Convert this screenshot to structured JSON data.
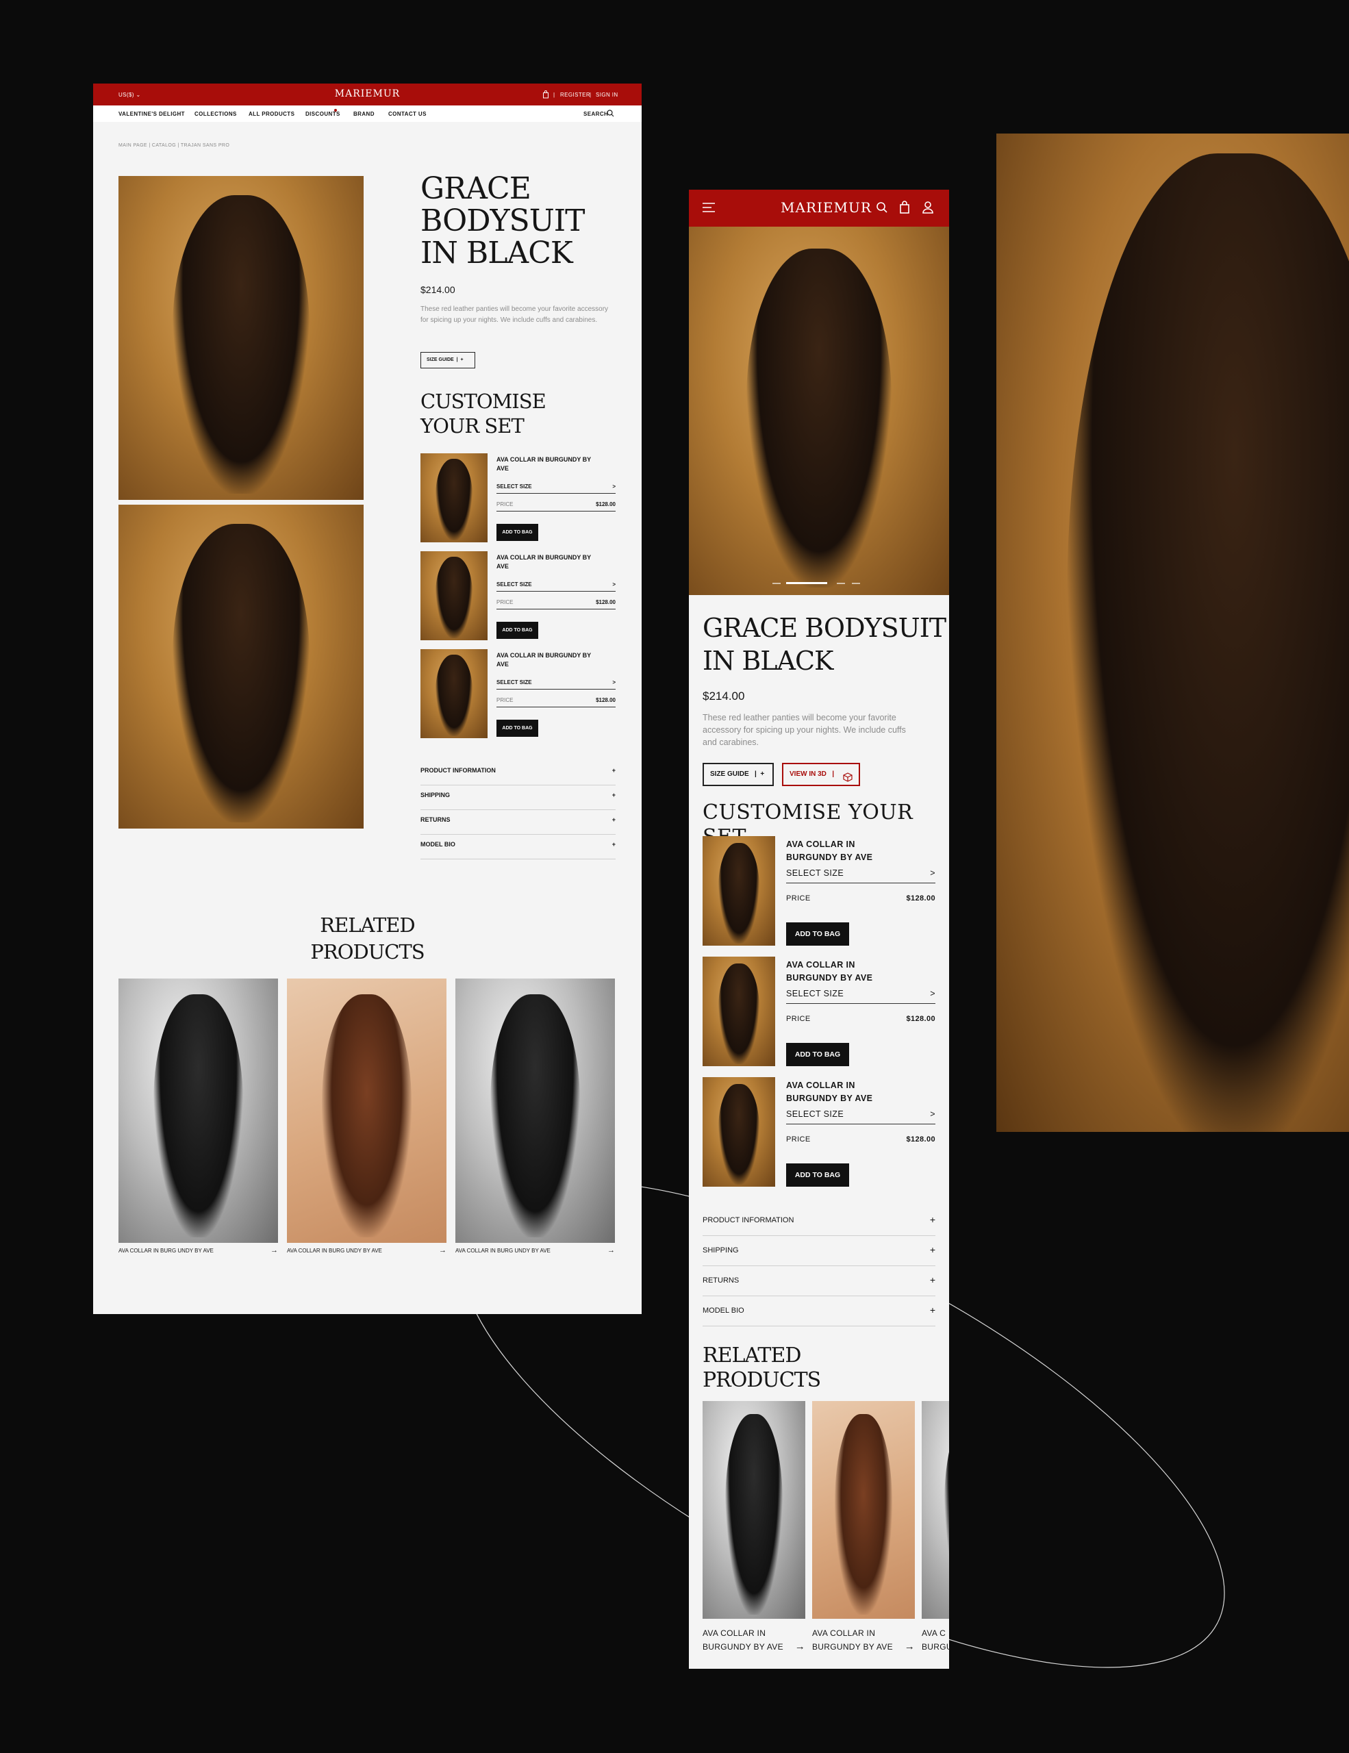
{
  "brand": "MARIEMUR",
  "desktop": {
    "currency": "US($)",
    "register": "REGISTER",
    "sign_in": "SIGN IN",
    "nav": [
      "VALENTINE'S DELIGHT",
      "COLLECTIONS",
      "ALL PRODUCTS",
      "DISCOUNTS",
      "BRAND",
      "CONTACT US"
    ],
    "search": "SEARCH",
    "breadcrumb": "MAIN PAGE | CATALOG | TRAJAN SANS PRO",
    "title_lines": [
      "GRACE",
      "BODYSUIT",
      "IN BLACK"
    ],
    "price": "$214.00",
    "description": "These red leather panties will become your favorite accessory for spicing up your nights. We include cuffs and carabines.",
    "size_guide": "SIZE GUIDE",
    "customise_lines": [
      "CUSTOMISE",
      "YOUR SET"
    ],
    "items": [
      {
        "name": "AVA COLLAR IN BURGUNDY BY AVE",
        "select": "SELECT SIZE",
        "price_label": "PRICE",
        "price": "$128.00",
        "button": "ADD TO BAG"
      },
      {
        "name": "AVA COLLAR IN BURGUNDY BY AVE",
        "select": "SELECT SIZE",
        "price_label": "PRICE",
        "price": "$128.00",
        "button": "ADD TO BAG"
      },
      {
        "name": "AVA COLLAR IN BURGUNDY BY AVE",
        "select": "SELECT SIZE",
        "price_label": "PRICE",
        "price": "$128.00",
        "button": "ADD TO BAG"
      }
    ],
    "accordion": [
      "PRODUCT INFORMATION",
      "SHIPPING",
      "RETURNS",
      "MODEL BIO"
    ],
    "related_lines": [
      "RELATED",
      "PRODUCTS"
    ],
    "related": [
      "AVA COLLAR IN BURG UNDY BY AVE",
      "AVA COLLAR IN BURG UNDY BY AVE",
      "AVA COLLAR IN BURG UNDY BY AVE"
    ]
  },
  "mobile": {
    "title_lines": [
      "GRACE BODYSUIT",
      "IN BLACK"
    ],
    "price": "$214.00",
    "description": "These red leather panties will become your favorite accessory for spicing up your nights. We include cuffs and carabines.",
    "size_guide": "SIZE GUIDE",
    "view_3d": "VIEW IN 3D",
    "customise": "CUSTOMISE YOUR SET",
    "items": [
      {
        "name": "AVA COLLAR IN BURGUNDY BY AVE",
        "select": "SELECT SIZE",
        "price_label": "PRICE",
        "price": "$128.00",
        "button": "ADD TO BAG"
      },
      {
        "name": "AVA COLLAR IN BURGUNDY BY AVE",
        "select": "SELECT SIZE",
        "price_label": "PRICE",
        "price": "$128.00",
        "button": "ADD TO BAG"
      },
      {
        "name": "AVA COLLAR IN BURGUNDY BY AVE",
        "select": "SELECT SIZE",
        "price_label": "PRICE",
        "price": "$128.00",
        "button": "ADD TO BAG"
      }
    ],
    "accordion": [
      "PRODUCT INFORMATION",
      "SHIPPING",
      "RETURNS",
      "MODEL BIO"
    ],
    "related_lines": [
      "RELATED",
      "PRODUCTS"
    ],
    "related": [
      {
        "l1": "AVA COLLAR IN",
        "l2": "BURGUNDY BY AVE"
      },
      {
        "l1": "AVA COLLAR IN",
        "l2": "BURGUNDY BY AVE"
      },
      {
        "l1": "AVA C",
        "l2": "BURGU"
      }
    ]
  },
  "colors": {
    "brand_red": "#a80d0a",
    "background": "#0b0b0b",
    "page": "#f4f4f4"
  },
  "icons": [
    "chevron-down-icon",
    "bag-icon",
    "search-icon",
    "menu-icon",
    "user-icon",
    "plus-icon",
    "arrow-right-icon",
    "cube-icon"
  ]
}
